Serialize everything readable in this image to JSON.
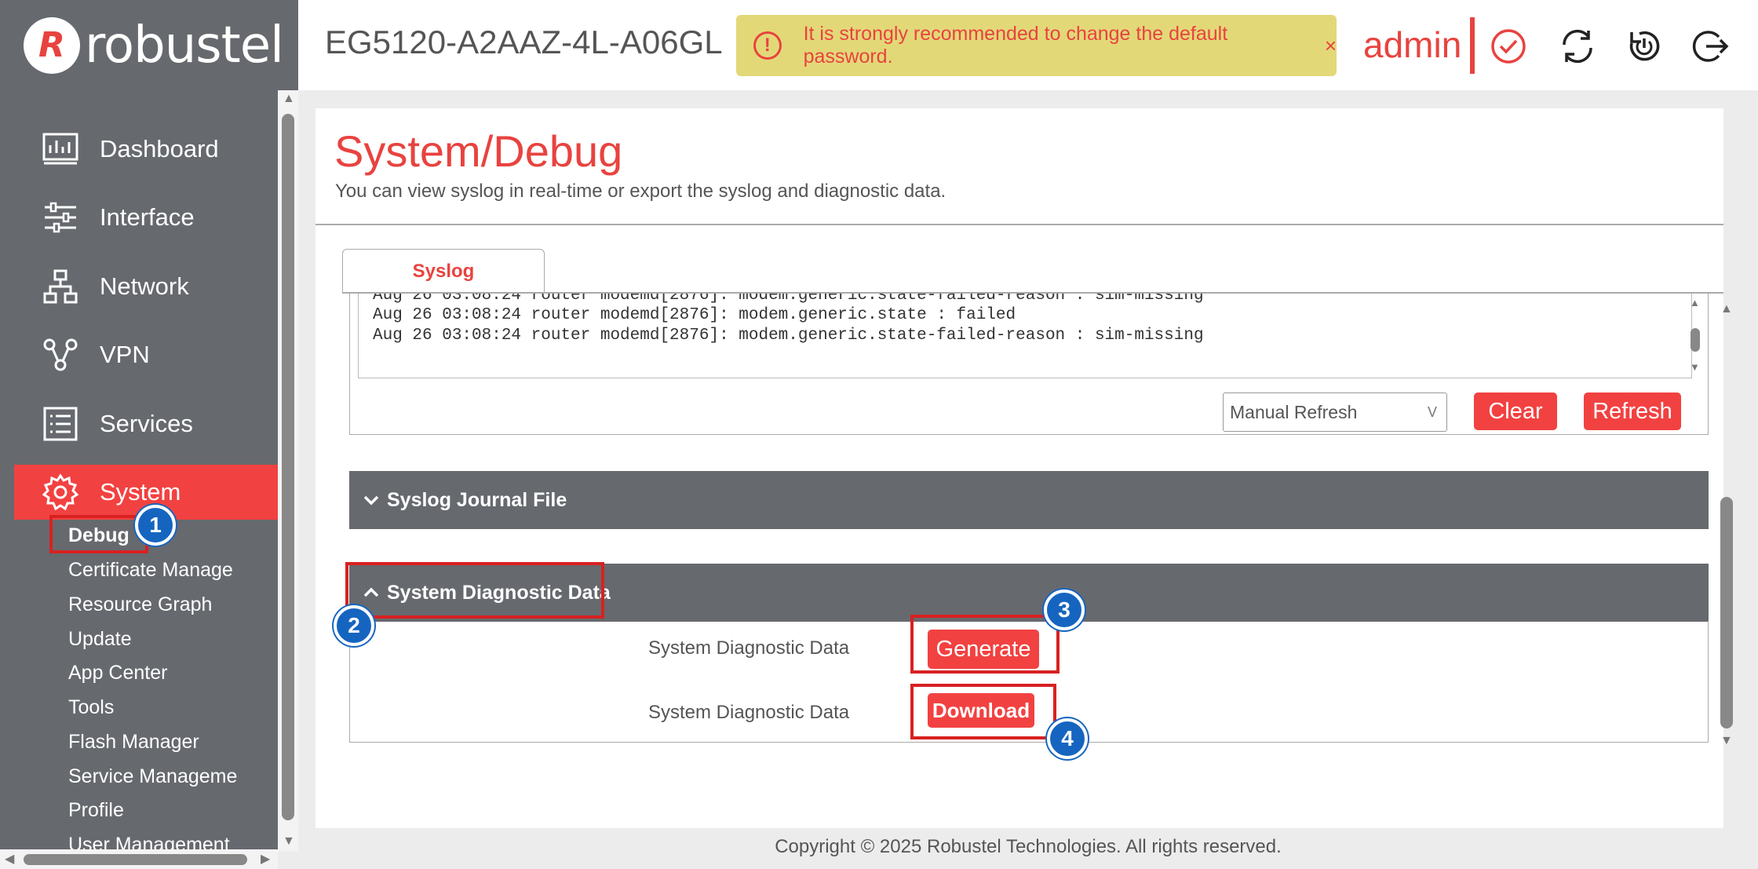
{
  "header": {
    "logo_text": "robustel",
    "device_name": "EG5120-A2AAZ-4L-A06GL",
    "warning_text": "It is strongly recommended to change the default password.",
    "warning_close": "×",
    "user": "admin",
    "icons": [
      "check-circle-icon",
      "sync-icon",
      "reboot-icon",
      "logout-icon"
    ]
  },
  "sidebar": {
    "items": [
      {
        "label": "Dashboard",
        "icon": "dashboard-icon"
      },
      {
        "label": "Interface",
        "icon": "sliders-icon"
      },
      {
        "label": "Network",
        "icon": "network-icon"
      },
      {
        "label": "VPN",
        "icon": "vpn-icon"
      },
      {
        "label": "Services",
        "icon": "list-icon"
      },
      {
        "label": "System",
        "icon": "gear-icon",
        "active": true
      }
    ],
    "subitems": [
      "Debug",
      "Certificate Manage",
      "Resource Graph",
      "Update",
      "App Center",
      "Tools",
      "Flash Manager",
      "Service Manageme",
      "Profile",
      "User Management"
    ]
  },
  "main": {
    "title": "System/Debug",
    "description": "You can view syslog in real-time or export the syslog and diagnostic data.",
    "tab": "Syslog",
    "log_lines": [
      "Aug 26 03:08:24 router modemd[2876]: modem.generic.state-failed-reason : sim-missing",
      "Aug 26 03:08:24 router modemd[2876]: modem.generic.state : failed",
      "Aug 26 03:08:24 router modemd[2876]: modem.generic.state-failed-reason : sim-missing"
    ],
    "refresh_mode": "Manual Refresh",
    "select_caret": "V",
    "clear_label": "Clear",
    "refresh_label": "Refresh",
    "journal_section": "Syslog Journal File",
    "diag_section": "System Diagnostic Data",
    "diag_rows": [
      {
        "label": "System Diagnostic Data",
        "button": "Generate"
      },
      {
        "label": "System Diagnostic Data",
        "button": "Download"
      }
    ]
  },
  "footer": "Copyright © 2025 Robustel Technologies. All rights reserved.",
  "annotations": [
    "1",
    "2",
    "3",
    "4"
  ],
  "colors": {
    "accent": "#f24141",
    "sidebar": "#66696e",
    "warning_bg": "#e3d878",
    "badge": "#1565c0"
  }
}
